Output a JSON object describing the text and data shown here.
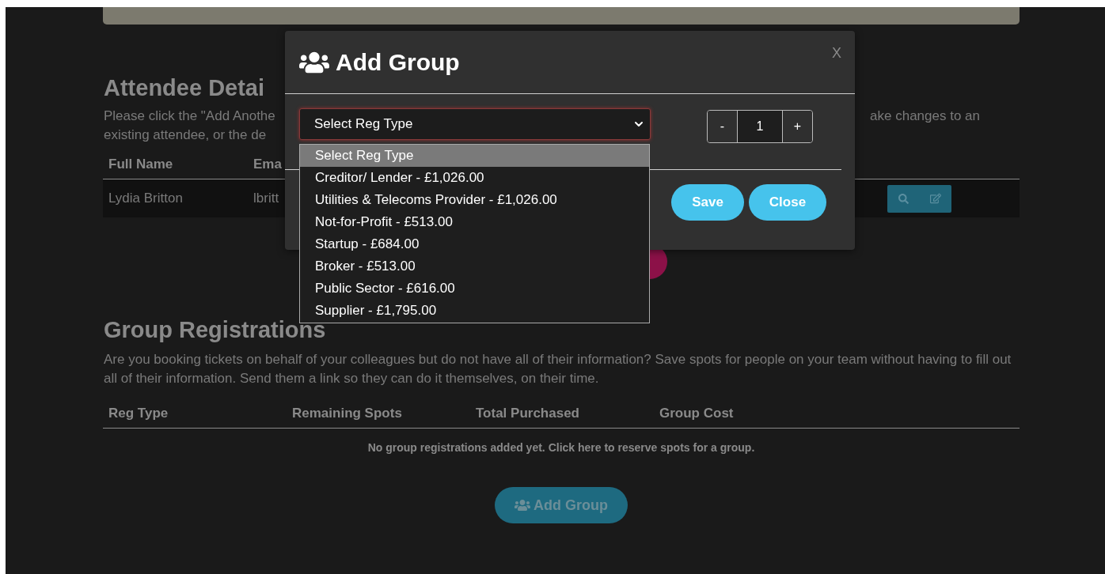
{
  "attendee_section": {
    "heading": "Attendee Detai",
    "paragraph_lines": [
      {
        "left": "Please click the \"Add Anothe",
        "right": "ake changes to an"
      },
      {
        "left": "existing attendee, or the de"
      }
    ],
    "columns": [
      "Full Name",
      "Ema"
    ],
    "rows": [
      {
        "cells": [
          "Lydia Britton",
          "lbritt"
        ]
      }
    ]
  },
  "group_section": {
    "heading": "Group Registrations",
    "description": "Are you booking tickets on behalf of your colleagues but do not have all of their information? Save spots for people on your team without having to fill out all of their information. Send them a link so they can do it themselves, on their time.",
    "columns": [
      "Reg Type",
      "Remaining Spots",
      "Total Purchased",
      "Group Cost"
    ],
    "empty_message": "No group registrations added yet. Click here to reserve spots for a group.",
    "add_button": "Add Group"
  },
  "modal": {
    "title": "Add Group",
    "close": "X",
    "select": {
      "value": "Select Reg Type",
      "expanded": true,
      "options": [
        {
          "label": "Select Reg Type",
          "selected": true
        },
        {
          "label": "Creditor/ Lender - £1,026.00",
          "selected": false
        },
        {
          "label": "Utilities & Telecoms Provider - £1,026.00",
          "selected": false
        },
        {
          "label": "Not-for-Profit - £513.00",
          "selected": false
        },
        {
          "label": "Startup - £684.00",
          "selected": false
        },
        {
          "label": "Broker - £513.00",
          "selected": false
        },
        {
          "label": "Public Sector - £616.00",
          "selected": false
        },
        {
          "label": "Supplier - £1,795.00",
          "selected": false
        }
      ]
    },
    "quantity": {
      "decrement": "-",
      "value": "1",
      "increment": "+"
    },
    "buttons": [
      "Save",
      "Close"
    ]
  }
}
